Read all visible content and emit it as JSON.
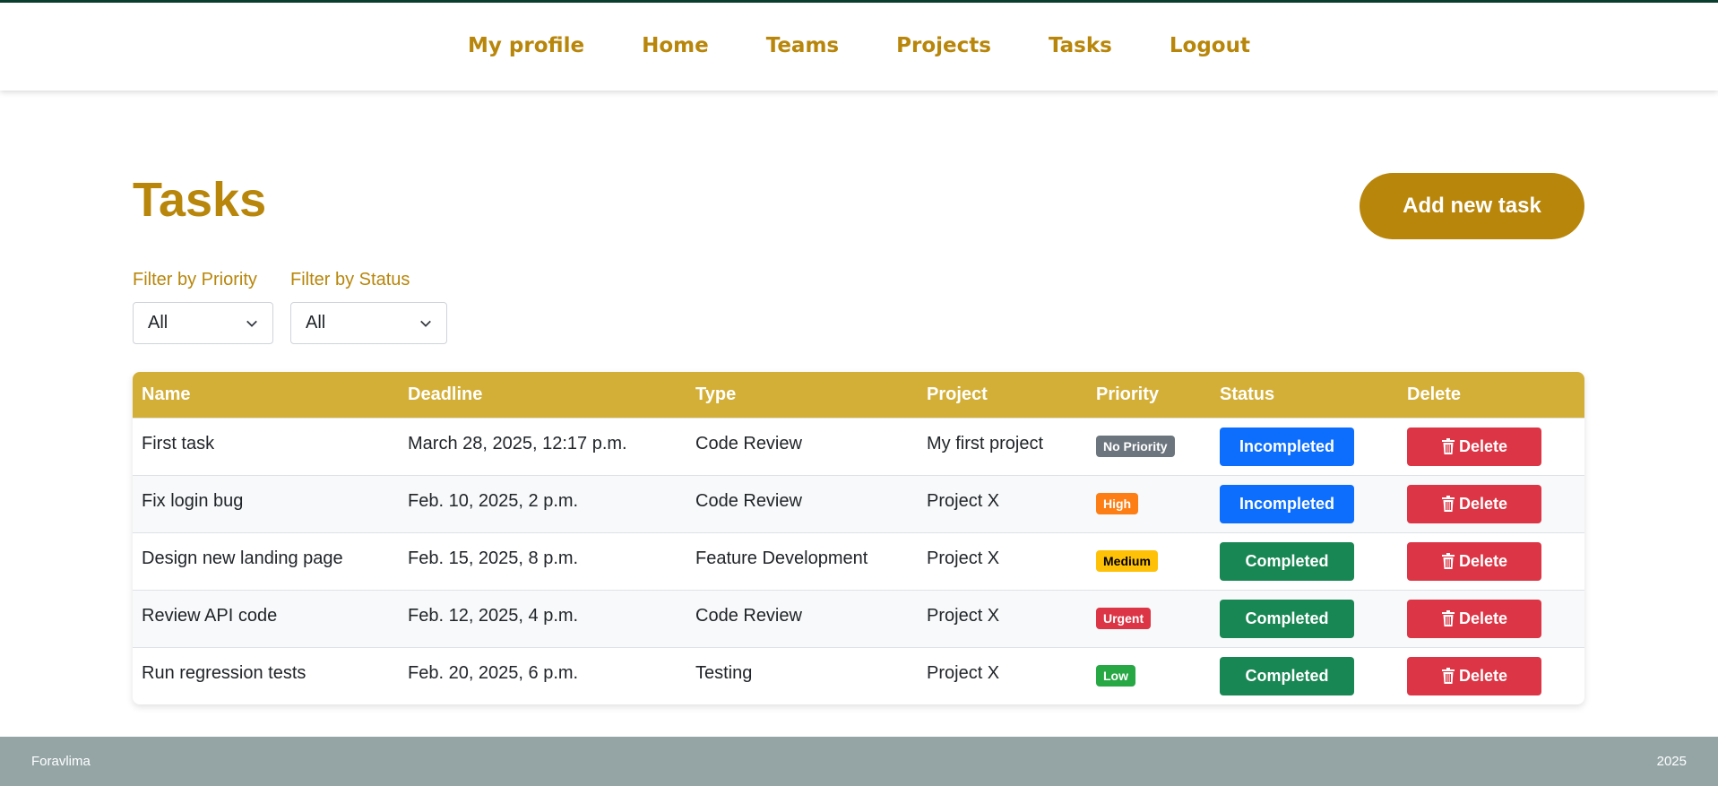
{
  "nav": {
    "items": [
      {
        "label": "My profile",
        "name": "nav-my-profile"
      },
      {
        "label": "Home",
        "name": "nav-home"
      },
      {
        "label": "Teams",
        "name": "nav-teams"
      },
      {
        "label": "Projects",
        "name": "nav-projects"
      },
      {
        "label": "Tasks",
        "name": "nav-tasks"
      },
      {
        "label": "Logout",
        "name": "nav-logout"
      }
    ]
  },
  "page": {
    "title": "Tasks",
    "add_button": "Add new task"
  },
  "filters": {
    "priority": {
      "label": "Filter by Priority",
      "value": "All"
    },
    "status": {
      "label": "Filter by Status",
      "value": "All"
    }
  },
  "table": {
    "headers": [
      "Name",
      "Deadline",
      "Type",
      "Project",
      "Priority",
      "Status",
      "Delete"
    ],
    "delete_label": "Delete",
    "rows": [
      {
        "name": "First task",
        "deadline": "March 28, 2025, 12:17 p.m.",
        "type": "Code Review",
        "project": "My first project",
        "priority": "No Priority",
        "priority_color": "#6c757d",
        "status": "Incompleted",
        "status_color": "#0d6efd"
      },
      {
        "name": "Fix login bug",
        "deadline": "Feb. 10, 2025, 2 p.m.",
        "type": "Code Review",
        "project": "Project X",
        "priority": "High",
        "priority_color": "#fd7e14",
        "status": "Incompleted",
        "status_color": "#0d6efd"
      },
      {
        "name": "Design new landing page",
        "deadline": "Feb. 15, 2025, 8 p.m.",
        "type": "Feature Development",
        "project": "Project X",
        "priority": "Medium",
        "priority_color": "#ffc107",
        "priority_text_color": "#000000",
        "status": "Completed",
        "status_color": "#198754"
      },
      {
        "name": "Review API code",
        "deadline": "Feb. 12, 2025, 4 p.m.",
        "type": "Code Review",
        "project": "Project X",
        "priority": "Urgent",
        "priority_color": "#dc3545",
        "status": "Completed",
        "status_color": "#198754"
      },
      {
        "name": "Run regression tests",
        "deadline": "Feb. 20, 2025, 6 p.m.",
        "type": "Testing",
        "project": "Project X",
        "priority": "Low",
        "priority_color": "#28a745",
        "status": "Completed",
        "status_color": "#198754"
      }
    ]
  },
  "footer": {
    "left": "Foravlima",
    "right": "2025"
  },
  "colors": {
    "accent": "#b8860b",
    "header_bg": "#d4af37",
    "footer_bg": "#95a5a6",
    "delete": "#dc3545"
  }
}
